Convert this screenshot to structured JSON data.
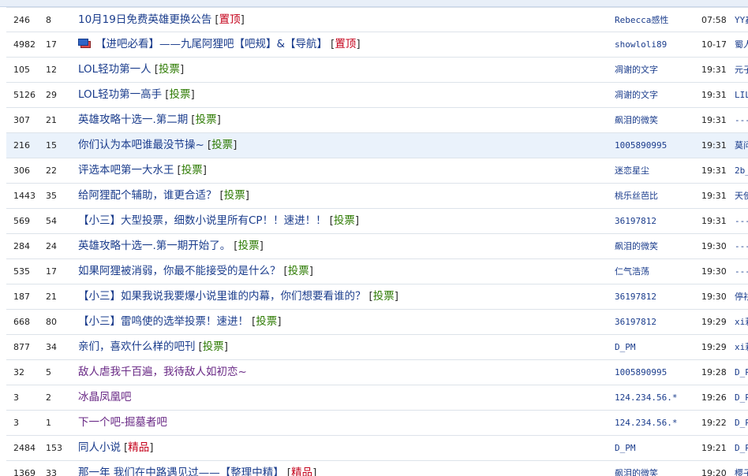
{
  "threads": [
    {
      "clicks": "246",
      "replies": "8",
      "title": "10月19日免费英雄更换公告",
      "tag": "置顶",
      "tag_color": "#c4001a",
      "author": "Rebecca感性",
      "time": "07:58",
      "last": "YY鑫",
      "icon": "",
      "visited": false
    },
    {
      "clicks": "4982",
      "replies": "17",
      "title": "【进吧必看】——九尾阿狸吧【吧规】&【导航】",
      "tag": "置顶",
      "tag_color": "#c4001a",
      "author": "showloli89",
      "time": "10-17",
      "last": "蜀人",
      "icon": "pinned-notice-icon",
      "visited": false
    },
    {
      "clicks": "105",
      "replies": "12",
      "title": "LOL轻功第一人",
      "tag": "投票",
      "tag_color": "#2c7a00",
      "author": "凋谢的文字",
      "time": "19:31",
      "last": "元子",
      "icon": "",
      "visited": false
    },
    {
      "clicks": "5126",
      "replies": "29",
      "title": "LOL轻功第一高手",
      "tag": "投票",
      "tag_color": "#2c7a00",
      "author": "凋谢的文字",
      "time": "19:31",
      "last": "LIL",
      "icon": "",
      "visited": false
    },
    {
      "clicks": "307",
      "replies": "21",
      "title": "英雄攻略十选一.第二期",
      "tag": "投票",
      "tag_color": "#2c7a00",
      "author": "飙泪的微笑",
      "time": "19:31",
      "last": "----",
      "icon": "",
      "visited": false
    },
    {
      "clicks": "216",
      "replies": "15",
      "title": "你们认为本吧谁最没节操~",
      "tag": "投票",
      "tag_color": "#2c7a00",
      "author": "1005890995",
      "time": "19:31",
      "last": "莫问",
      "icon": "",
      "visited": false
    },
    {
      "clicks": "306",
      "replies": "22",
      "title": "评选本吧第一大水王",
      "tag": "投票",
      "tag_color": "#2c7a00",
      "author": "迷恋星尘",
      "time": "19:31",
      "last": "2b_",
      "icon": "",
      "visited": false
    },
    {
      "clicks": "1443",
      "replies": "35",
      "title": "给阿狸配个辅助，谁更合适？",
      "tag": "投票",
      "tag_color": "#2c7a00",
      "author": "桃乐丝芭比",
      "time": "19:31",
      "last": "天使",
      "icon": "",
      "visited": false
    },
    {
      "clicks": "569",
      "replies": "54",
      "title": "【小三】大型投票，细数小说里所有CP！！速进！！",
      "tag": "投票",
      "tag_color": "#2c7a00",
      "author": "36197812",
      "time": "19:31",
      "last": "----",
      "icon": "",
      "visited": false
    },
    {
      "clicks": "284",
      "replies": "24",
      "title": "英雄攻略十选一.第一期开始了。",
      "tag": "投票",
      "tag_color": "#2c7a00",
      "author": "飙泪的微笑",
      "time": "19:30",
      "last": "----",
      "icon": "",
      "visited": false
    },
    {
      "clicks": "535",
      "replies": "17",
      "title": "如果阿狸被消弱，你最不能接受的是什么？",
      "tag": "投票",
      "tag_color": "#2c7a00",
      "author": "仁气浩荡",
      "time": "19:30",
      "last": "----",
      "icon": "",
      "visited": false
    },
    {
      "clicks": "187",
      "replies": "21",
      "title": "【小三】如果我说我要爆小说里谁的内幕，你们想要看谁的？",
      "tag": "投票",
      "tag_color": "#2c7a00",
      "author": "36197812",
      "time": "19:30",
      "last": "停衫",
      "icon": "",
      "visited": false
    },
    {
      "clicks": "668",
      "replies": "80",
      "title": "【小三】雷鸣使的选举投票！速进！",
      "tag": "投票",
      "tag_color": "#2c7a00",
      "author": "36197812",
      "time": "19:29",
      "last": "xi莉",
      "icon": "",
      "visited": false
    },
    {
      "clicks": "877",
      "replies": "34",
      "title": "亲们，喜欢什么样的吧刊",
      "tag": "投票",
      "tag_color": "#2c7a00",
      "author": "D_PM",
      "time": "19:29",
      "last": "xi莉",
      "icon": "",
      "visited": false
    },
    {
      "clicks": "32",
      "replies": "5",
      "title": "敌人虐我千百遍，我待敌人如初恋~",
      "tag": "",
      "tag_color": "",
      "author": "1005890995",
      "time": "19:28",
      "last": "D_P",
      "icon": "",
      "visited": true
    },
    {
      "clicks": "3",
      "replies": "2",
      "title": "冰晶凤凰吧",
      "tag": "",
      "tag_color": "",
      "author": "124.234.56.*",
      "time": "19:26",
      "last": "D_P",
      "icon": "",
      "visited": true
    },
    {
      "clicks": "3",
      "replies": "1",
      "title": "下一个吧-掘墓者吧",
      "tag": "",
      "tag_color": "",
      "author": "124.234.56.*",
      "time": "19:22",
      "last": "D_P",
      "icon": "",
      "visited": true
    },
    {
      "clicks": "2484",
      "replies": "153",
      "title": "同人小说",
      "tag": "精品",
      "tag_color": "#c4001a",
      "author": "D_PM",
      "time": "19:21",
      "last": "D_P",
      "icon": "",
      "visited": false
    },
    {
      "clicks": "1369",
      "replies": "33",
      "title": "那一年 我们在中路遇见过——【整理中精】",
      "tag": "精品",
      "tag_color": "#c4001a",
      "author": "飙泪的微笑",
      "time": "19:20",
      "last": "樱子",
      "icon": "",
      "visited": false
    }
  ],
  "highlighted_index": 5
}
